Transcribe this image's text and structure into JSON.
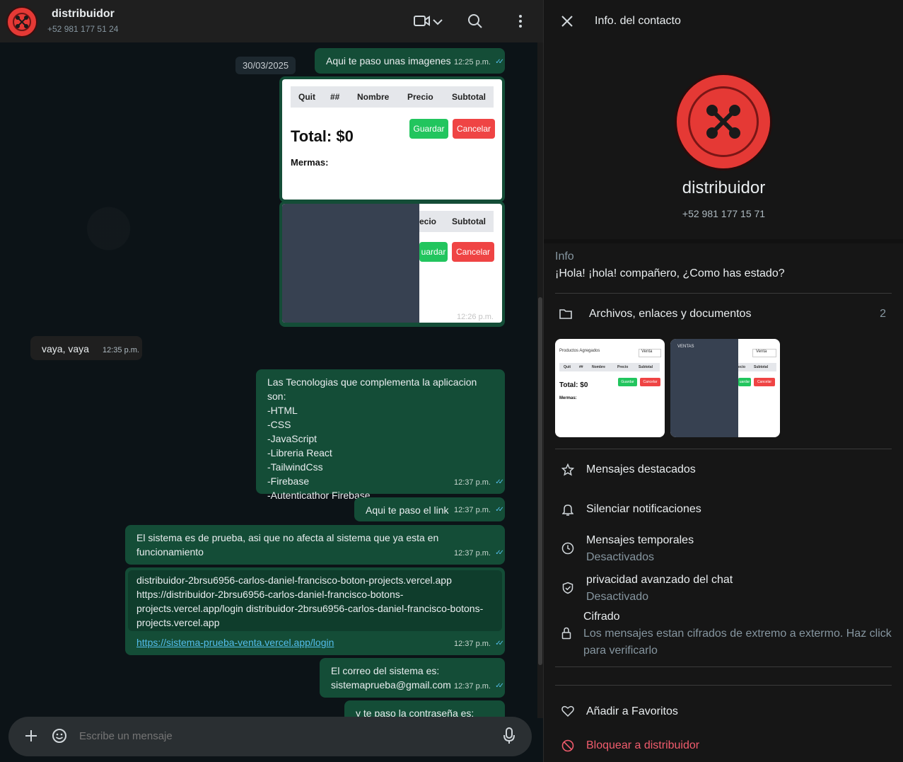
{
  "chat": {
    "contact_name": "distribuidor",
    "contact_phone": "+52 981 177 51 24",
    "date_label": "30/03/2025",
    "composer_placeholder": "Escribe un mensaje"
  },
  "messages": {
    "m1": {
      "text": "Aqui te paso unas imagenes",
      "time": "12:25 p.m."
    },
    "img1": {
      "headers": [
        "Quit",
        "##",
        "Nombre",
        "Precio",
        "Subtotal"
      ],
      "total": "Total: $0",
      "guardar": "Guardar",
      "cancelar": "Cancelar",
      "mermas": "Mermas:"
    },
    "img2": {
      "headers": [
        "ecio",
        "Subtotal"
      ],
      "guardar": "uardar",
      "cancelar": "Cancelar",
      "time": "12:26 p.m."
    },
    "m2": {
      "text": "vaya, vaya",
      "time": "12:35 p.m."
    },
    "m3": {
      "lines": [
        "Las Tecnologias que complementa la aplicacion son:",
        "-HTML",
        "-CSS",
        "-JavaScript",
        "-Libreria React",
        "-TailwindCss",
        "-Firebase",
        "-Autenticathor Firebase"
      ],
      "time": "12:37 p.m."
    },
    "m4": {
      "text": "Aqui te paso el link",
      "time": "12:37 p.m."
    },
    "m5": {
      "line1": "El sistema es de prueba, asi que no afecta al sistema que ya esta en",
      "line2": "funcionamiento",
      "time": "12:37 p.m."
    },
    "m6": {
      "line1": "distribuidor-2brsu6956-carlos-daniel-francisco-boton-projects.vercel.app",
      "line2": "https://distribuidor-2brsu6956-carlos-daniel-francisco-botons-",
      "line3": "projects.vercel.app/login distribuidor-2brsu6956-carlos-daniel-francisco-botons-",
      "line4": "projects.vercel.app",
      "link": "https://sistema-prueba-venta.vercel.app/login",
      "time": "12:37 p.m."
    },
    "m7": {
      "line1": "El correo del sistema es:",
      "line2": "sistemaprueba@gmail.com",
      "time": "12:37 p.m."
    },
    "m8": {
      "text": "y te paso la contraseña es:"
    }
  },
  "info": {
    "title": "Info. del contacto",
    "name": "distribuidor",
    "phone": "+52 981 177 15 71",
    "info_label": "Info",
    "info_text": "¡Hola! ¡hola! compañero, ¿Como has estado?",
    "files_label": "Archivos, enlaces y documentos",
    "files_count": "2",
    "thumb1": {
      "title": "Productos Agregados",
      "select": "Venta",
      "headers": [
        "Quit",
        "##",
        "Nombre",
        "Precio",
        "Subtotal"
      ],
      "total": "Total: $0",
      "guardar": "Guardar",
      "cancelar": "Cancelar",
      "mermas": "Mermas:"
    },
    "thumb2": {
      "label": "VENTAS",
      "select": "Venta",
      "headers": [
        "ecio",
        "Subtotal"
      ],
      "guardar": "uardar",
      "cancelar": "Cancelar"
    },
    "starred": "Mensajes destacados",
    "mute": "Silenciar notificaciones",
    "temp_title": "Mensajes temporales",
    "temp_sub": "Desactivados",
    "privacy_title": "privacidad avanzado del chat",
    "privacy_sub": "Desactivado",
    "encryption_title": "Cifrado",
    "encryption_line1": "Los mensajes estan cifrados de extremo a extermo. Haz click",
    "encryption_line2": "para verificarlo",
    "favorite": "Añadir a Favoritos",
    "block": "Bloquear a distribuidor"
  },
  "colors": {
    "outgoing_bubble": "#144d37",
    "incoming_bubble": "#1f1f1f",
    "avatar_red": "#e53935",
    "danger": "#f15c6d",
    "read_tick": "#53bdeb"
  },
  "icons": [
    "video-call-icon",
    "chevron-down-icon",
    "search-icon",
    "menu-icon",
    "close-icon",
    "folder-icon",
    "star-icon",
    "bell-icon",
    "clock-icon",
    "shield-icon",
    "lock-icon",
    "heart-icon",
    "block-icon",
    "plus-icon",
    "emoji-icon",
    "mic-icon"
  ]
}
